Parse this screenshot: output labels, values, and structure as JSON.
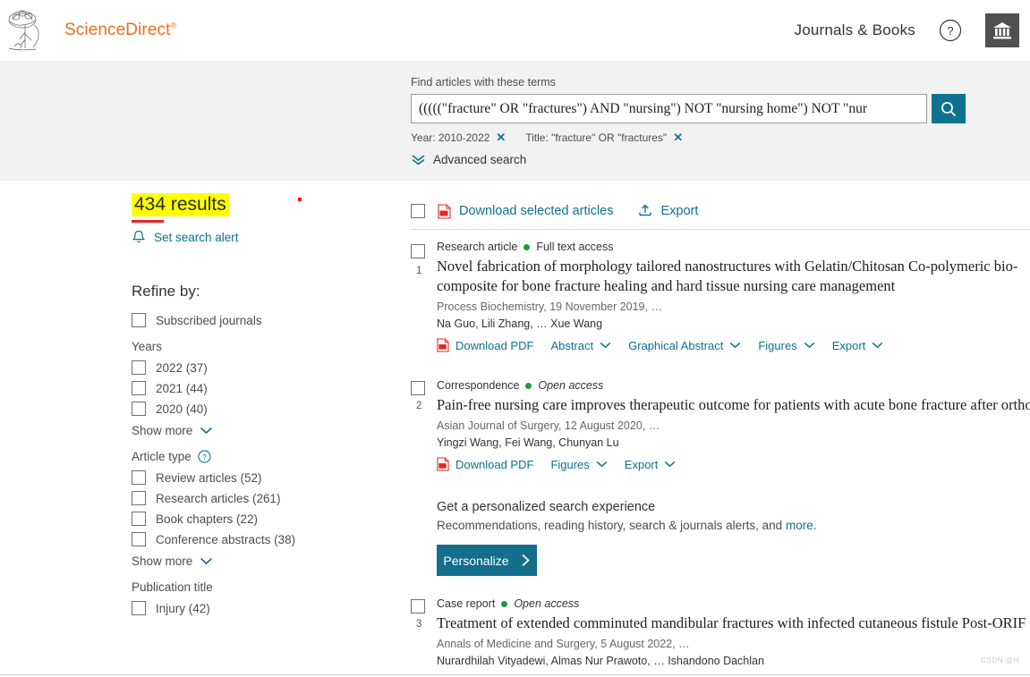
{
  "header": {
    "brand_name": "ScienceDirect",
    "journals_books": "Journals & Books",
    "help_icon": "question-circle-icon",
    "institution_icon": "institution-building-icon",
    "logo_icon": "elsevier-tree-logo"
  },
  "search": {
    "label": "Find articles with these terms",
    "query": "(((((\"fracture\" OR \"fractures\") AND \"nursing\") NOT \"nursing home\") NOT \"nur",
    "placeholder": "",
    "search_icon": "magnifier-icon",
    "chips": [
      {
        "text": "Year: 2010-2022",
        "remove_icon": "close-x-icon"
      },
      {
        "text": "Title: \"fracture\" OR \"fractures\"",
        "remove_icon": "close-x-icon"
      }
    ],
    "advanced_search": "Advanced search",
    "advanced_icon": "double-chevron-down-icon"
  },
  "sidebar": {
    "results_count": "434 results",
    "set_alert": "Set search alert",
    "alert_icon": "bell-icon",
    "refine_by": "Refine by:",
    "subscribed": "Subscribed journals",
    "groups": [
      {
        "title": "Years",
        "items": [
          {
            "label": "2022 (37)"
          },
          {
            "label": "2021 (44)"
          },
          {
            "label": "2020 (40)"
          }
        ],
        "show_more": "Show more"
      },
      {
        "title": "Article type",
        "help_icon": "question-circle-icon",
        "items": [
          {
            "label": "Review articles (52)"
          },
          {
            "label": "Research articles (261)"
          },
          {
            "label": "Book chapters (22)"
          },
          {
            "label": "Conference abstracts (38)"
          }
        ],
        "show_more": "Show more"
      },
      {
        "title": "Publication title",
        "items": [
          {
            "label": "Injury (42)"
          }
        ]
      }
    ]
  },
  "results_toolbar": {
    "download_selected": "Download selected articles",
    "pdf_icon": "pdf-file-icon",
    "export": "Export",
    "export_icon": "upload-export-icon"
  },
  "results": [
    {
      "number": "1",
      "type": "Research article",
      "access": "Full text access",
      "open_access": false,
      "title": "Novel fabrication of morphology tailored nanostructures with Gelatin/Chitosan Co-polymeric bio-composite for bone fracture healing and hard tissue nursing care management",
      "meta": "Process Biochemistry, 19 November 2019, …",
      "authors": "Na Guo, Lili Zhang, … Xue Wang",
      "actions": [
        {
          "label": "Download PDF",
          "icon": "pdf-file-icon"
        },
        {
          "label": "Abstract",
          "icon": "chevron-down-icon"
        },
        {
          "label": "Graphical Abstract",
          "icon": "chevron-down-icon"
        },
        {
          "label": "Figures",
          "icon": "chevron-down-icon"
        },
        {
          "label": "Export",
          "icon": "chevron-down-icon"
        }
      ]
    },
    {
      "number": "2",
      "type": "Correspondence",
      "access": "Open access",
      "open_access": true,
      "title": "Pain-free nursing care improves therapeutic outcome for patients with acute bone fracture after orthopedic",
      "meta": "Asian Journal of Surgery, 12 August 2020, …",
      "authors": "Yingzi Wang, Fei Wang, Chunyan Lu",
      "actions": [
        {
          "label": "Download PDF",
          "icon": "pdf-file-icon"
        },
        {
          "label": "Figures",
          "icon": "chevron-down-icon"
        },
        {
          "label": "Export",
          "icon": "chevron-down-icon"
        }
      ]
    },
    {
      "number": "3",
      "type": "Case report",
      "access": "Open access",
      "open_access": true,
      "title": "Treatment of extended comminuted mandibular fractures with infected cutaneous fistule Post-ORIF using",
      "meta": "Annals of Medicine and Surgery, 5 August 2022, …",
      "authors": "Nurardhilah Vityadewi, Almas Nur Prawoto, … Ishandono Dachlan",
      "actions": []
    }
  ],
  "personalize": {
    "title": "Get a personalized search experience",
    "subtitle_before": "Recommendations, reading history, search & journals alerts, and ",
    "subtitle_link": "more",
    "subtitle_after": ".",
    "button": "Personalize",
    "button_icon": "chevron-right-icon"
  },
  "watermark": "CSDN @H",
  "colors": {
    "brand_orange": "#e9711c",
    "link_teal": "#0d7290",
    "button_teal": "#136f8b",
    "band_gray": "#f2f2f2",
    "highlight_yellow": "#ffff00",
    "underline_red": "#e8261f",
    "open_access_green": "#1a9e3c",
    "pdf_red": "#e8261f"
  }
}
